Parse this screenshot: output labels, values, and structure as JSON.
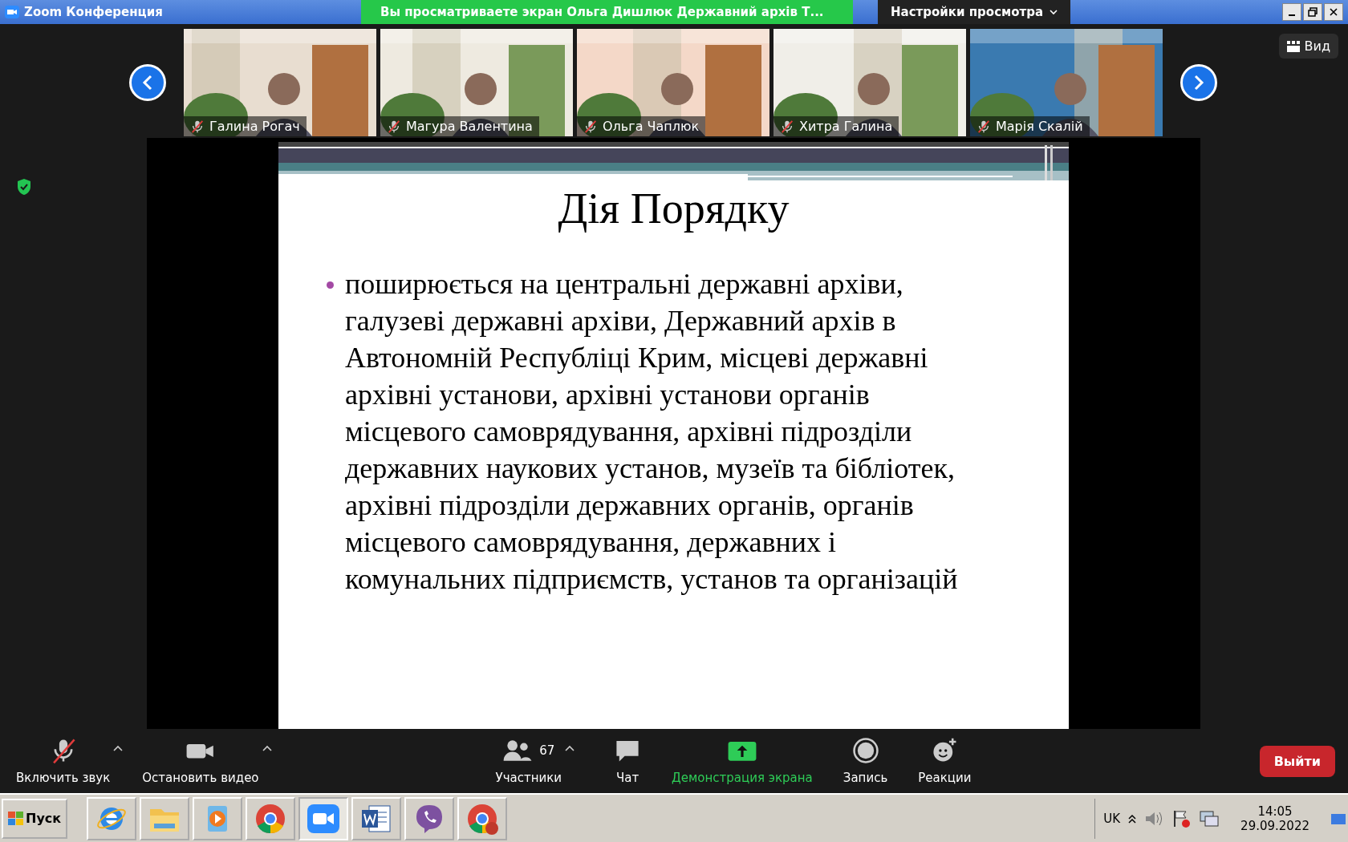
{
  "window": {
    "title": "Zoom Конференция",
    "banner": "Вы просматриваете экран Ольга Дишлюк Державний архів Т...",
    "view_settings": "Настройки просмотра"
  },
  "participants": [
    {
      "name": "Галина Рогач",
      "muted": true
    },
    {
      "name": "Магура Валентина",
      "muted": true
    },
    {
      "name": "Ольга Чаплюк",
      "muted": true
    },
    {
      "name": "Хитра Галина",
      "muted": true
    },
    {
      "name": "Марія Скалій",
      "muted": true
    }
  ],
  "view_button": "Вид",
  "slide": {
    "title": "Дія Порядку",
    "bullets": [
      "поширюється на центральні державні архіви, галузеві державні архіви, Державний архів в Автономній Республіці Крим, місцеві державні архівні установи, архівні установи органів місцевого самоврядування, архівні підрозділи державних наукових установ, музеїв та бібліотек, архівні підрозділи державних органів, органів місцевого самоврядування, державних і комунальних підприємств, установ та організацій"
    ]
  },
  "toolbar": [
    {
      "kind": "mic",
      "label": "Включить звук",
      "muted": true,
      "caret": true
    },
    {
      "kind": "video",
      "label": "Остановить видео",
      "caret": true
    },
    {
      "kind": "participants",
      "label": "Участники",
      "count": "67",
      "caret": true
    },
    {
      "kind": "chat",
      "label": "Чат"
    },
    {
      "kind": "share",
      "label": "Демонстрация экрана",
      "active": true
    },
    {
      "kind": "record",
      "label": "Запись"
    },
    {
      "kind": "reactions",
      "label": "Реакции"
    }
  ],
  "leave_button": "Выйти",
  "taskbar": {
    "start": "Пуск",
    "apps": [
      {
        "kind": "ie",
        "selected": false
      },
      {
        "kind": "folder",
        "selected": false
      },
      {
        "kind": "player",
        "selected": false
      },
      {
        "kind": "chrome",
        "selected": false
      },
      {
        "kind": "zoom",
        "selected": true
      },
      {
        "kind": "word",
        "selected": false
      },
      {
        "kind": "viber",
        "selected": false
      },
      {
        "kind": "chrome-p",
        "selected": false
      }
    ],
    "language": "UK",
    "time": "14:05",
    "date": "29.09.2022"
  }
}
